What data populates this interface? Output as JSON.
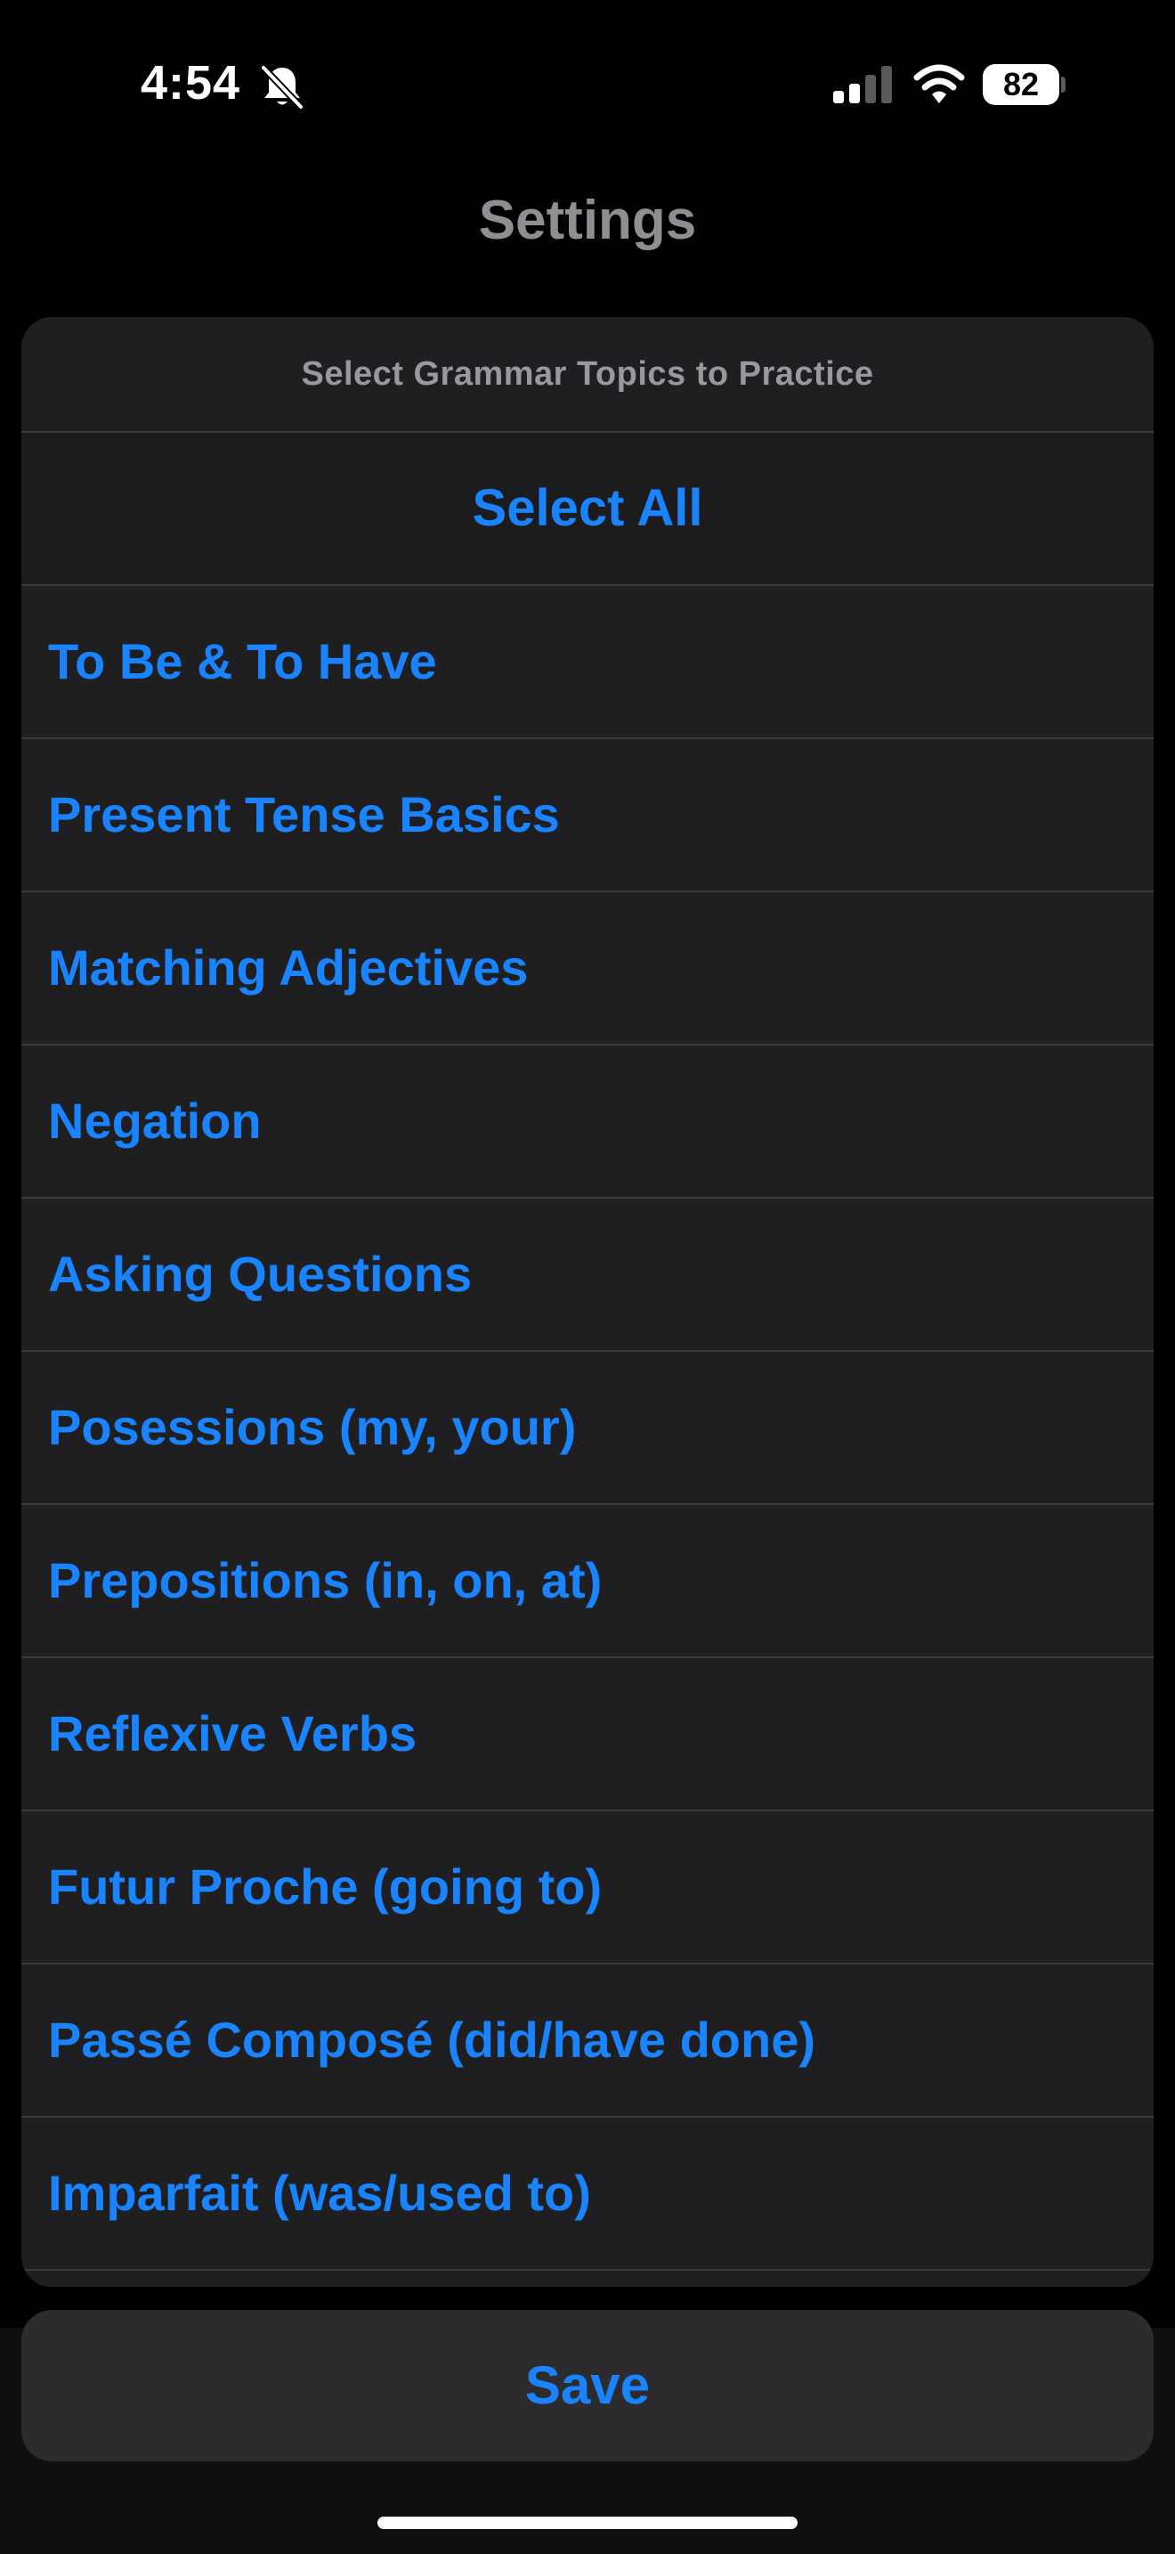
{
  "status_bar": {
    "time": "4:54",
    "battery_level": "82",
    "icons": [
      "bell-slash-icon",
      "cellular-signal-icon",
      "wifi-icon",
      "battery-icon"
    ]
  },
  "header": {
    "title": "Settings"
  },
  "panel": {
    "section_title": "Select Grammar Topics to Practice",
    "select_all_label": "Select All",
    "topics": [
      {
        "label": "To Be & To Have"
      },
      {
        "label": "Present Tense Basics"
      },
      {
        "label": "Matching Adjectives"
      },
      {
        "label": "Negation"
      },
      {
        "label": "Asking Questions"
      },
      {
        "label": "Posessions (my, your)"
      },
      {
        "label": "Prepositions (in, on, at)"
      },
      {
        "label": "Reflexive Verbs"
      },
      {
        "label": "Futur Proche (going to)"
      },
      {
        "label": "Passé Composé (did/have done)"
      },
      {
        "label": "Imparfait (was/used to)"
      }
    ]
  },
  "footer": {
    "save_label": "Save"
  },
  "colors": {
    "accent": "#1a84ff",
    "background": "#000000",
    "panel": "#1f1f21",
    "secondary_text": "#8e8e93"
  }
}
